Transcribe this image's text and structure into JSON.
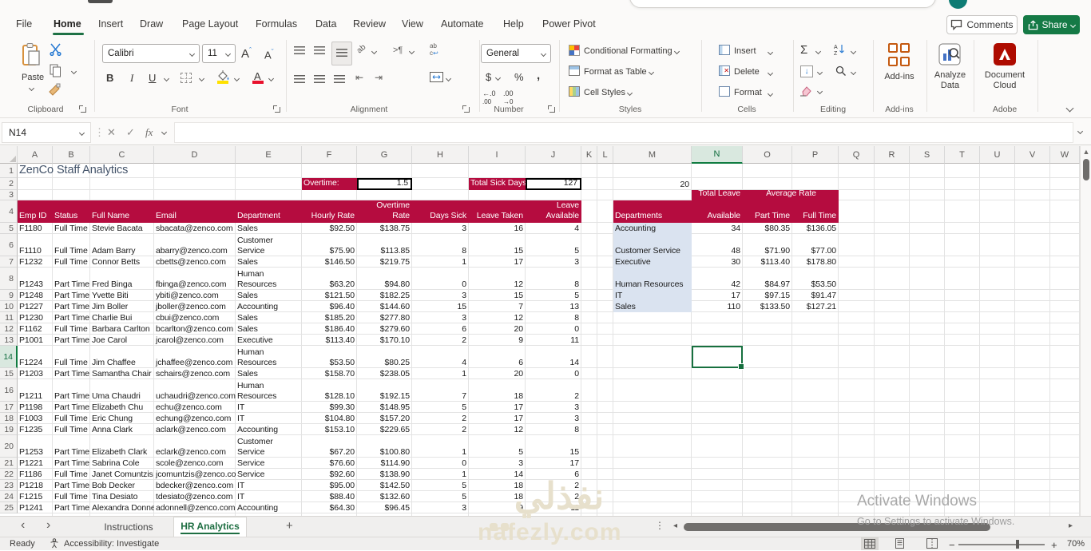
{
  "topbar": {
    "comments_label": "Comments",
    "share_label": "Share"
  },
  "menu": {
    "tabs": [
      "File",
      "Home",
      "Insert",
      "Draw",
      "Page Layout",
      "Formulas",
      "Data",
      "Review",
      "View",
      "Automate",
      "Help",
      "Power Pivot"
    ],
    "active_tab": "Home"
  },
  "ribbon": {
    "paste_label": "Paste",
    "font_name": "Calibri",
    "font_size": "11",
    "number_format": "General",
    "styles_items": [
      "Conditional Formatting",
      "Format as Table",
      "Cell Styles"
    ],
    "cells_items": [
      "Insert",
      "Delete",
      "Format"
    ],
    "addins_label": "Add-ins",
    "analyze_label": "Analyze Data",
    "doccloud_label": "Document Cloud",
    "group_labels": {
      "clipboard": "Clipboard",
      "font": "Font",
      "alignment": "Alignment",
      "number": "Number",
      "styles": "Styles",
      "cells": "Cells",
      "editing": "Editing",
      "addins": "Add-ins",
      "adobe": "Adobe"
    }
  },
  "formula_bar": {
    "cell_reference": "N14",
    "fx_label": "fx"
  },
  "sheet": {
    "columns": [
      "A",
      "B",
      "C",
      "D",
      "E",
      "F",
      "G",
      "H",
      "I",
      "J",
      "K",
      "L",
      "M",
      "N",
      "O",
      "P",
      "Q",
      "R",
      "S",
      "T",
      "U",
      "V",
      "W"
    ],
    "row_count": 25,
    "selected_cell": "N14",
    "title": "ZenCo Staff Analytics",
    "overtime_label": "Overtime:",
    "overtime_value": "1.5",
    "sick_label": "Total Sick Days",
    "sick_value": "127",
    "m2_value": "20",
    "main_table": {
      "headers": [
        "Emp ID",
        "Status",
        "Full Name",
        "Email",
        "Department",
        "Hourly Rate",
        "Overtime Rate",
        "Days Sick",
        "Leave Taken",
        "Leave Available"
      ],
      "rows": [
        [
          "F1180",
          "Full Time",
          "Stevie Bacata",
          "sbacata@zenco.com",
          "Sales",
          "$92.50",
          "$138.75",
          "3",
          "16",
          "4"
        ],
        [
          "F1110",
          "Full Time",
          "Adam Barry",
          "abarry@zenco.com",
          "Customer Service",
          "$75.90",
          "$113.85",
          "8",
          "15",
          "5"
        ],
        [
          "F1232",
          "Full Time",
          "Connor Betts",
          "cbetts@zenco.com",
          "Sales",
          "$146.50",
          "$219.75",
          "1",
          "17",
          "3"
        ],
        [
          "P1243",
          "Part Time",
          "Fred Binga",
          "fbinga@zenco.com",
          "Human Resources",
          "$63.20",
          "$94.80",
          "0",
          "12",
          "8"
        ],
        [
          "P1248",
          "Part Time",
          "Yvette Biti",
          "ybiti@zenco.com",
          "Sales",
          "$121.50",
          "$182.25",
          "3",
          "15",
          "5"
        ],
        [
          "P1227",
          "Part Time",
          "Jim Boller",
          "jboller@zenco.com",
          "Accounting",
          "$96.40",
          "$144.60",
          "15",
          "7",
          "13"
        ],
        [
          "P1230",
          "Part Time",
          "Charlie Bui",
          "cbui@zenco.com",
          "Sales",
          "$185.20",
          "$277.80",
          "3",
          "12",
          "8"
        ],
        [
          "F1162",
          "Full Time",
          "Barbara Carlton",
          "bcarlton@zenco.com",
          "Sales",
          "$186.40",
          "$279.60",
          "6",
          "20",
          "0"
        ],
        [
          "P1001",
          "Part Time",
          "Joe Carol",
          "jcarol@zenco.com",
          "Executive",
          "$113.40",
          "$170.10",
          "2",
          "9",
          "11"
        ],
        [
          "F1224",
          "Full Time",
          "Jim Chaffee",
          "jchaffee@zenco.com",
          "Human Resources",
          "$53.50",
          "$80.25",
          "4",
          "6",
          "14"
        ],
        [
          "P1203",
          "Part Time",
          "Samantha Chair",
          "schairs@zenco.com",
          "Sales",
          "$158.70",
          "$238.05",
          "1",
          "20",
          "0"
        ],
        [
          "P1211",
          "Part Time",
          "Uma Chaudri",
          "uchaudri@zenco.com",
          "Human Resources",
          "$128.10",
          "$192.15",
          "7",
          "18",
          "2"
        ],
        [
          "P1198",
          "Part Time",
          "Elizabeth Chu",
          "echu@zenco.com",
          "IT",
          "$99.30",
          "$148.95",
          "5",
          "17",
          "3"
        ],
        [
          "F1003",
          "Full Time",
          "Eric Chung",
          "echung@zenco.com",
          "IT",
          "$104.80",
          "$157.20",
          "2",
          "17",
          "3"
        ],
        [
          "F1235",
          "Full Time",
          "Anna Clark",
          "aclark@zenco.com",
          "Accounting",
          "$153.10",
          "$229.65",
          "2",
          "12",
          "8"
        ],
        [
          "P1253",
          "Part Time",
          "Elizabeth Clark",
          "eclark@zenco.com",
          "Customer Service",
          "$67.20",
          "$100.80",
          "1",
          "5",
          "15"
        ],
        [
          "P1221",
          "Part Time",
          "Sabrina Cole",
          "scole@zenco.com",
          "Service",
          "$76.60",
          "$114.90",
          "0",
          "3",
          "17"
        ],
        [
          "F1186",
          "Full Time",
          "Janet Comuntzis",
          "jcomuntzis@zenco.com",
          "Service",
          "$92.60",
          "$138.90",
          "1",
          "14",
          "6"
        ],
        [
          "P1218",
          "Part Time",
          "Bob Decker",
          "bdecker@zenco.com",
          "IT",
          "$95.00",
          "$142.50",
          "5",
          "18",
          "2"
        ],
        [
          "F1215",
          "Full Time",
          "Tina Desiato",
          "tdesiato@zenco.com",
          "IT",
          "$88.40",
          "$132.60",
          "5",
          "18",
          "2"
        ],
        [
          "P1241",
          "Part Time",
          "Alexandra Donnell",
          "adonnell@zenco.com",
          "Accounting",
          "$64.30",
          "$96.45",
          "3",
          "9",
          "11"
        ]
      ]
    },
    "summary_table": {
      "leave_header": "Total Leave",
      "rate_header": "Average Rate",
      "headers": [
        "Departments",
        "Available",
        "Part Time",
        "Full Time"
      ],
      "rows": [
        [
          "Accounting",
          "34",
          "$80.35",
          "$136.05"
        ],
        [
          "Customer Service",
          "48",
          "$71.90",
          "$77.00"
        ],
        [
          "Executive",
          "30",
          "$113.40",
          "$178.80"
        ],
        [
          "Human Resources",
          "42",
          "$84.97",
          "$53.50"
        ],
        [
          "IT",
          "17",
          "$97.15",
          "$91.47"
        ],
        [
          "Sales",
          "110",
          "$133.50",
          "$127.21"
        ]
      ]
    }
  },
  "sheet_tabs": {
    "items": [
      "Instructions",
      "HR Analytics"
    ],
    "active": "HR Analytics"
  },
  "status_bar": {
    "mode": "Ready",
    "accessibility": "Accessibility: Investigate",
    "zoom_level": "70%"
  },
  "watermark": {
    "brand_arabic": "نفذلي",
    "brand_domain": "nafezly.com",
    "activate_line1": "Activate Windows",
    "activate_line2": "Go to Settings to activate Windows."
  },
  "colors": {
    "accent_green": "#1E7145",
    "header_maroon": "#B50C3F",
    "dept_blue": "#DAE3F0",
    "adobe_red": "#AE0B00"
  }
}
